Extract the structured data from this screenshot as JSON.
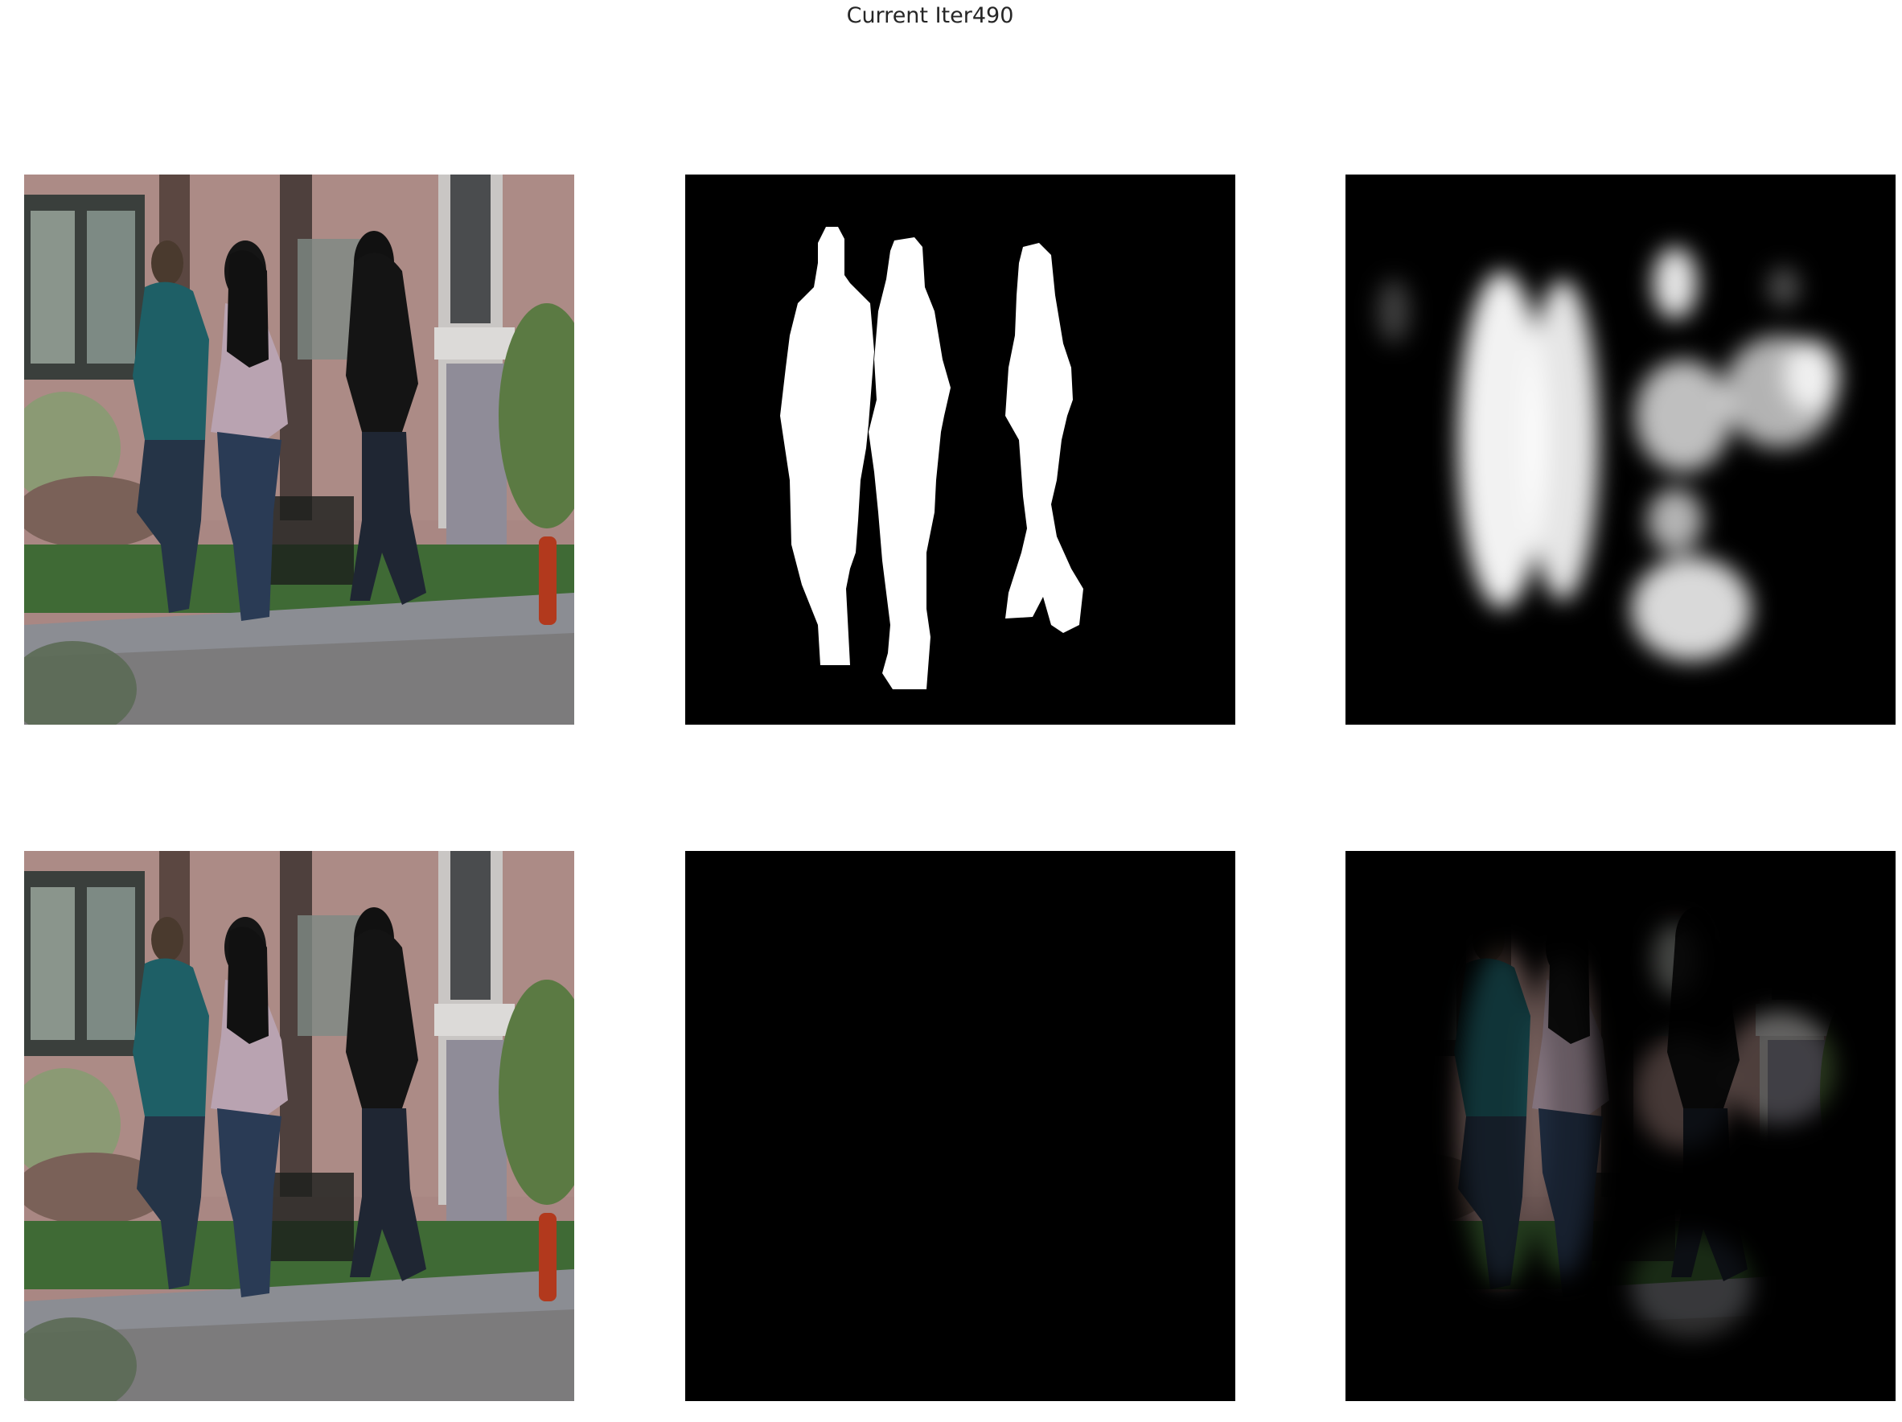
{
  "figure": {
    "suptitle": "Current Iter490"
  },
  "panels": [
    {
      "row": 0,
      "col": 0,
      "content": "input-photo"
    },
    {
      "row": 0,
      "col": 1,
      "content": "ground-truth-mask"
    },
    {
      "row": 0,
      "col": 2,
      "content": "predicted-mask"
    },
    {
      "row": 1,
      "col": 0,
      "content": "input-photo"
    },
    {
      "row": 1,
      "col": 1,
      "content": "ground-truth-masked-photo"
    },
    {
      "row": 1,
      "col": 2,
      "content": "predicted-masked-photo"
    }
  ],
  "colors": {
    "background": "#ffffff",
    "title": "#262626",
    "mask_fg": "#ffffff",
    "mask_bg": "#000000",
    "brick": "#a98783",
    "teal_shirt": "#1e5f66",
    "pink_shirt": "#b9a3b1",
    "jeans": "#253447",
    "hair": "#141414",
    "grass": "#3f6a35",
    "pavement": "#8b8d93"
  }
}
